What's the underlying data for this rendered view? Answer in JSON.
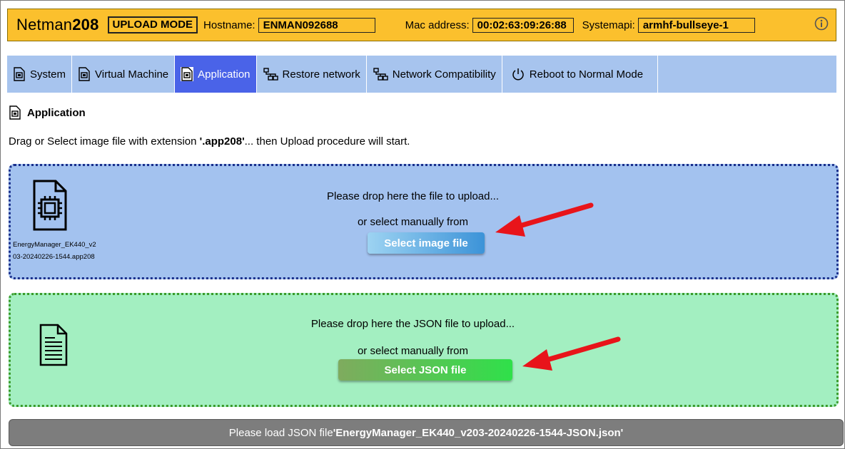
{
  "header": {
    "brand_light": "Netman",
    "brand_bold": "208",
    "mode": "UPLOAD MODE",
    "hostname_label": "Hostname:",
    "hostname": "ENMAN092688",
    "mac_label": "Mac address:",
    "mac": "00:02:63:09:26:88",
    "systemapi_label": "Systemapi:",
    "systemapi": "armhf-bullseye-1"
  },
  "tabs": [
    {
      "label": "System",
      "icon": "chip-icon"
    },
    {
      "label": "Virtual Machine",
      "icon": "chip-icon"
    },
    {
      "label": "Application",
      "icon": "chip-icon",
      "active": true
    },
    {
      "label": "Restore network",
      "icon": "network-icon"
    },
    {
      "label": "Network Compatibility",
      "icon": "network-icon"
    },
    {
      "label": "Reboot to Normal Mode",
      "icon": "power-icon"
    }
  ],
  "section": {
    "title": "Application",
    "desc_prefix": "Drag or Select image file with extension ",
    "desc_ext": "'.app208'",
    "desc_suffix": "... then Upload procedure will start."
  },
  "image_zone": {
    "drop_text": "Please drop here the file to upload...",
    "or_text": "or select manually from",
    "button": "Select image file",
    "file_name_line1": "EnergyManager_EK440_v2",
    "file_name_line2": "03-20240226-1544.app208"
  },
  "json_zone": {
    "drop_text": "Please drop here the JSON file to upload...",
    "or_text": "or select manually from",
    "button": "Select JSON file"
  },
  "status": {
    "prefix": "Please load JSON file ",
    "file": "'EnergyManager_EK440_v203-20240226-1544-JSON.json'"
  },
  "colors": {
    "header_bg": "#fbc02d",
    "tab_bar": "#a7c4ee",
    "tab_active": "#4a63e8",
    "image_zone": "#a3c2ef",
    "json_zone": "#a3efc1",
    "arrow": "#e8141a",
    "status_bg": "#7d7d7d"
  }
}
